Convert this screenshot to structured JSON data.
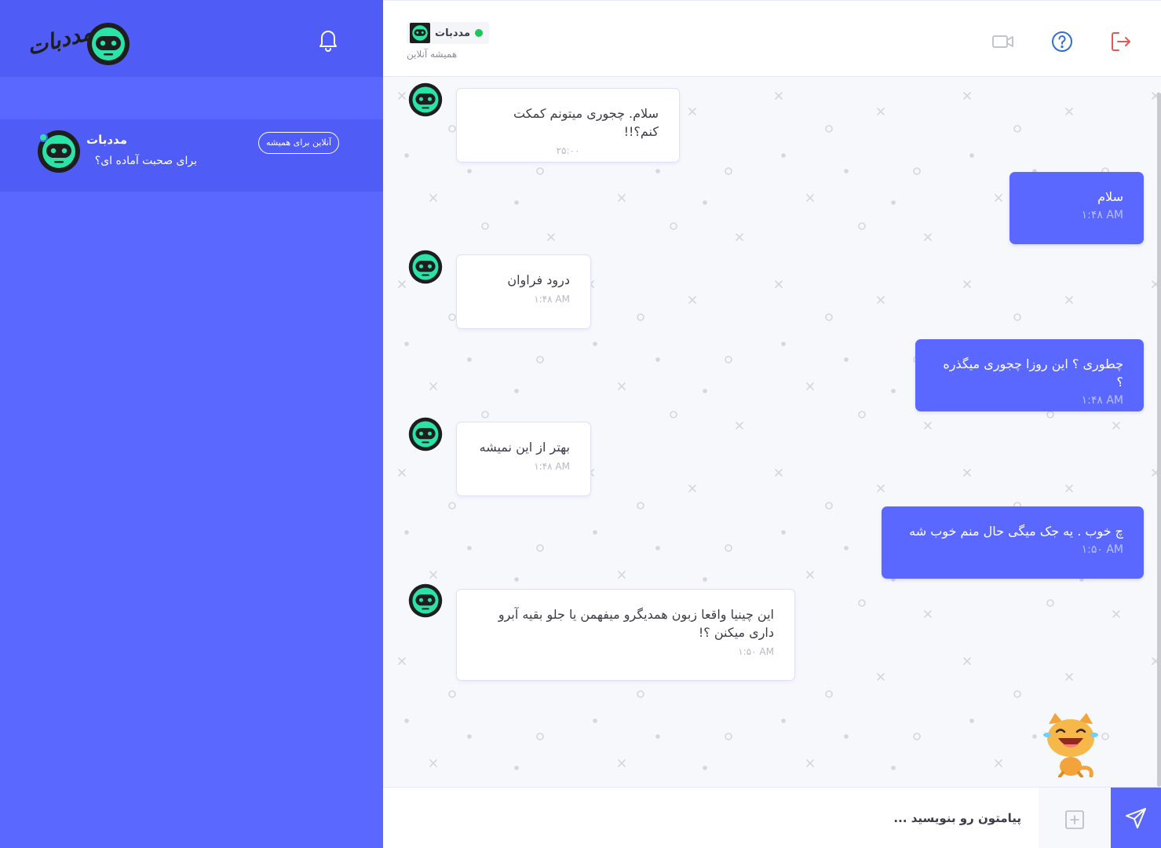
{
  "app": {
    "logo_text": "مددبات"
  },
  "sidebar": {
    "chat_item": {
      "name": "مددبات",
      "subtitle": "برای صحبت آماده ای؟",
      "badge": "آنلاین برای همیشه"
    }
  },
  "header": {
    "contact_name": "مددبات",
    "contact_status": "همیشه آنلاین",
    "icons": [
      "video-camera-icon",
      "help-icon",
      "logout-icon"
    ]
  },
  "messages": [
    {
      "sender": "bot",
      "text": "سلام. چجوری میتونم کمکت کنم؟!!",
      "time": "۲۵:۰۰"
    },
    {
      "sender": "user",
      "text": "سلام",
      "time": "۱:۴۸ AM"
    },
    {
      "sender": "bot",
      "text": "درود فراوان",
      "time": "۱:۴۸ AM"
    },
    {
      "sender": "user",
      "text": "چطوری ؟ این روزا چجوری میگذره ؟",
      "time": "۱:۴۸ AM"
    },
    {
      "sender": "bot",
      "text": "بهتر از این نمیشه",
      "time": "۱:۴۸ AM"
    },
    {
      "sender": "user",
      "text": "چ خوب . یه جک میگی حال منم خوب شه",
      "time": "۱:۵۰ AM"
    },
    {
      "sender": "bot",
      "text": "این چینیا واقعا زبون همدیگرو میفهمن یا جلو بقیه آبرو داری میکنن ؟!",
      "time": "۱:۵۰ AM"
    }
  ],
  "composer": {
    "placeholder": "پیامتون رو بنویسید ..."
  },
  "colors": {
    "primary": "#5a68ff",
    "primary_dark": "#4f5cf5",
    "online": "#1fc45a",
    "robot_face": "#2be3a6",
    "logout": "#e05a52",
    "help": "#2f6fd0"
  }
}
